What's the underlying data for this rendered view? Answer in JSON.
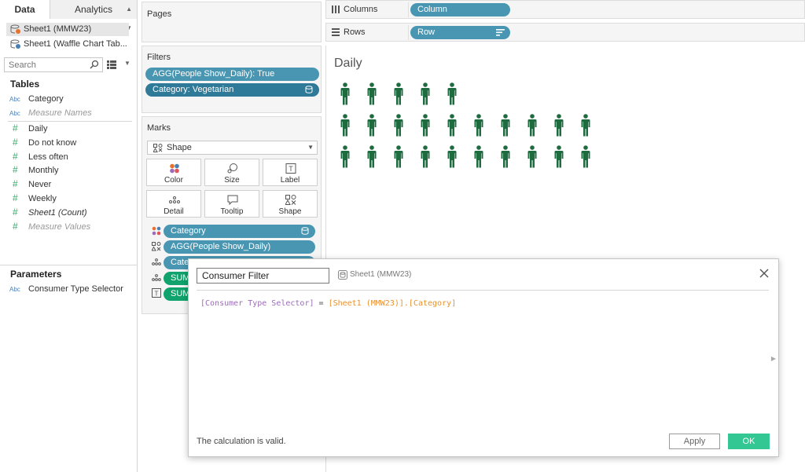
{
  "data_pane": {
    "tabs": [
      {
        "label": "Data"
      },
      {
        "label": "Analytics"
      }
    ],
    "datasources": [
      {
        "label": "Sheet1 (MMW23)",
        "selected": true
      },
      {
        "label": "Sheet1 (Waffle Chart Tab..."
      }
    ],
    "search": {
      "placeholder": "Search"
    },
    "tables_title": "Tables",
    "dimension_fields": [
      {
        "type": "Abc",
        "name": "Category"
      },
      {
        "type": "Abc",
        "name": "Measure Names"
      }
    ],
    "measure_fields": [
      {
        "type": "#",
        "name": "Daily"
      },
      {
        "type": "#",
        "name": "Do not know"
      },
      {
        "type": "#",
        "name": "Less often"
      },
      {
        "type": "#",
        "name": "Monthly"
      },
      {
        "type": "#",
        "name": "Never"
      },
      {
        "type": "#",
        "name": "Weekly"
      },
      {
        "type": "#",
        "name": "Sheet1 (Count)"
      },
      {
        "type": "#",
        "name": "Measure Values"
      }
    ],
    "parameters_title": "Parameters",
    "parameters": [
      {
        "type": "Abc",
        "name": "Consumer Type Selector"
      }
    ]
  },
  "pages": {
    "title": "Pages"
  },
  "filters": {
    "title": "Filters",
    "pills": [
      "AGG(People Show_Daily): True",
      "Category: Vegetarian"
    ]
  },
  "marks": {
    "title": "Marks",
    "mark_type": "Shape",
    "buttons": [
      "Color",
      "Size",
      "Label",
      "Detail",
      "Tooltip",
      "Shape"
    ],
    "pills": [
      "Category",
      "AGG(People Show_Daily)",
      "Cate",
      "SUM",
      "SUM"
    ]
  },
  "columns_shelf": {
    "label": "Columns",
    "pill": "Column"
  },
  "rows_shelf": {
    "label": "Rows",
    "pill": "Row"
  },
  "view": {
    "title": "Daily",
    "person_color": "#1e6b3f",
    "rows": [
      5,
      10,
      10
    ]
  },
  "dialog": {
    "name": "Consumer Filter",
    "source": "Sheet1 (MMW23)",
    "formula": {
      "param": "[Consumer Type Selector]",
      "op": " = ",
      "field": "[Sheet1 (MMW23)].[Category]"
    },
    "status": "The calculation is valid.",
    "apply": "Apply",
    "ok": "OK"
  }
}
